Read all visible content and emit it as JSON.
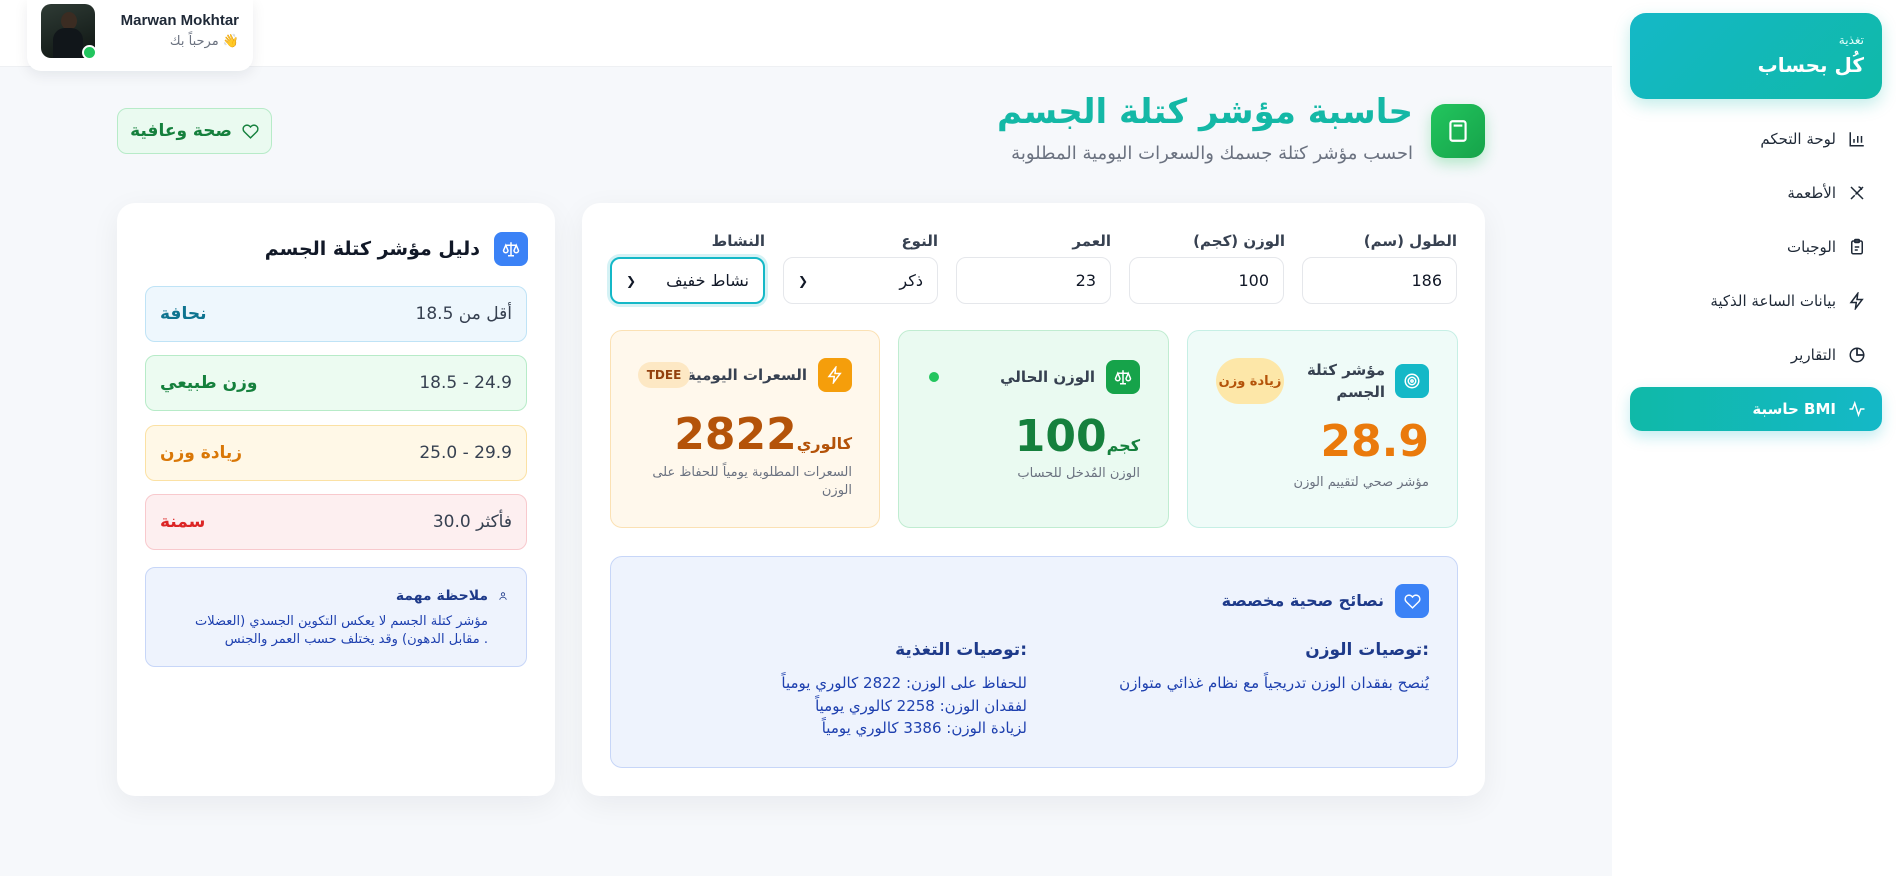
{
  "user": {
    "name": "Marwan Mokhtar",
    "greeting": "مرحباً بك 👋"
  },
  "brand": {
    "subtitle": "تغذية",
    "title": "كُل بحساب"
  },
  "nav": {
    "dashboard": "لوحة التحكم",
    "foods": "الأطعمة",
    "meals": "الوجبات",
    "smartwatch": "بيانات الساعة الذكية",
    "reports": "التقارير",
    "bmi": "حاسبة BMI"
  },
  "header": {
    "title": "حاسبة مؤشر كتلة الجسم",
    "subtitle": "احسب مؤشر كتلة جسمك والسعرات اليومية المطلوبة",
    "badge": "صحة وعافية"
  },
  "form": {
    "height_label": "الطول (سم)",
    "height_value": "186",
    "weight_label": "الوزن (كجم)",
    "weight_value": "100",
    "age_label": "العمر",
    "age_value": "23",
    "gender_label": "النوع",
    "gender_value": "ذكر",
    "activity_label": "النشاط",
    "activity_value": "نشاط خفيف"
  },
  "stats": {
    "bmi": {
      "title": "مؤشر كتلة الجسم",
      "badge": "زيادة وزن",
      "value": "28.9",
      "desc": "مؤشر صحي لتقييم الوزن"
    },
    "weight": {
      "title": "الوزن الحالي",
      "value": "100",
      "unit": "كجم",
      "desc": "الوزن المُدخل للحساب"
    },
    "calories": {
      "title": "السعرات اليومية",
      "badge": "TDEE",
      "value": "2822",
      "unit": "كالوري",
      "desc": "السعرات المطلوبة يومياً للحفاظ على الوزن"
    }
  },
  "tips": {
    "title": "نصائح صحية مخصصة",
    "weight_title": "توصيات الوزن:",
    "weight_text": "يُنصح بفقدان الوزن تدريجياً مع نظام غذائي متوازن",
    "nutrition_title": "توصيات التغذية:",
    "nutrition_lines": [
      "للحفاظ على الوزن: 2822 كالوري يومياً",
      "لفقدان الوزن: 2258 كالوري يومياً",
      "لزيادة الوزن: 3386 كالوري يومياً"
    ]
  },
  "guide": {
    "title": "دليل مؤشر كتلة الجسم",
    "ranges": [
      {
        "range": "أقل من 18.5",
        "category": "نحافة",
        "color": "#0e7490"
      },
      {
        "range": "18.5 - 24.9",
        "category": "وزن طبيعي",
        "color": "#15803d"
      },
      {
        "range": "25.0 - 29.9",
        "category": "زيادة وزن",
        "color": "#c2410c"
      },
      {
        "range": "30.0 فأكثر",
        "category": "سمنة",
        "color": "#dc2626"
      }
    ],
    "note_title": "ملاحظة مهمة",
    "note_text": "مؤشر كتلة الجسم لا يعكس التكوين الجسدي (العضلات مقابل الدهون) وقد يختلف حسب العمر والجنس ."
  },
  "colors": {
    "accent": "#14b8c7",
    "primary_green": "#16a34a",
    "bmi_value": "#ea7a0c",
    "weight_value": "#15803d",
    "calories_value": "#b45309"
  }
}
